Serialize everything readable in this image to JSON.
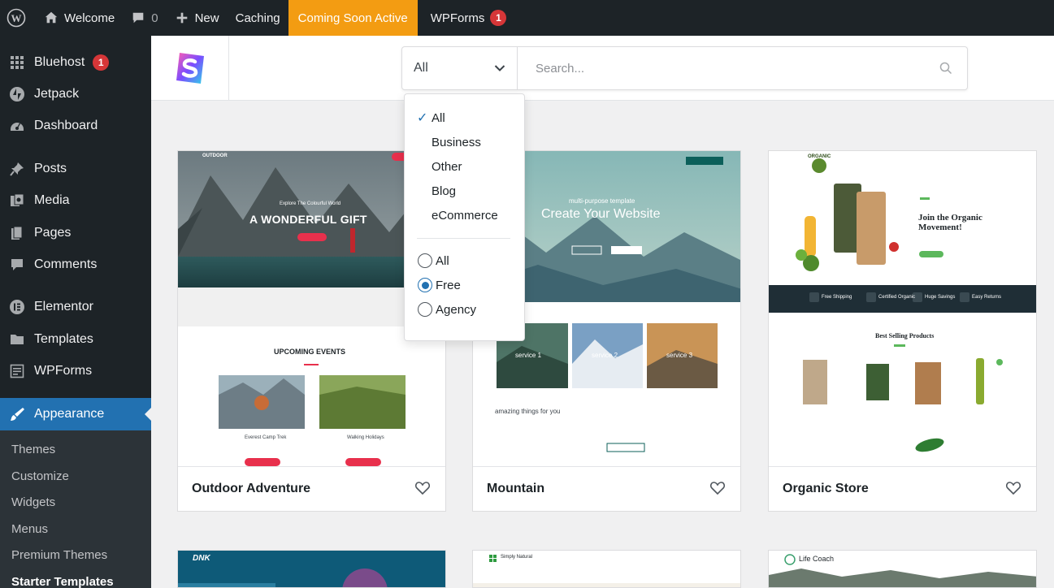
{
  "adminbar": {
    "site_name": "Welcome",
    "comments_count": "0",
    "new_label": "New",
    "caching_label": "Caching",
    "coming_soon_label": "Coming Soon Active",
    "wpforms_label": "WPForms",
    "wpforms_badge": "1",
    "highlight_color": "#f39c12"
  },
  "sidebar": {
    "items": [
      {
        "label": "Bluehost",
        "badge": "1",
        "icon": "grid-icon"
      },
      {
        "label": "Jetpack",
        "icon": "jetpack-icon"
      },
      {
        "label": "Dashboard",
        "icon": "dashboard-icon"
      },
      {
        "label": "Posts",
        "icon": "pin-icon"
      },
      {
        "label": "Media",
        "icon": "media-icon"
      },
      {
        "label": "Pages",
        "icon": "pages-icon"
      },
      {
        "label": "Comments",
        "icon": "comment-icon"
      },
      {
        "label": "Elementor",
        "icon": "elementor-icon"
      },
      {
        "label": "Templates",
        "icon": "folder-icon"
      },
      {
        "label": "WPForms",
        "icon": "form-icon"
      },
      {
        "label": "Appearance",
        "icon": "brush-icon"
      }
    ],
    "submenu": [
      "Themes",
      "Customize",
      "Widgets",
      "Menus",
      "Premium Themes",
      "Starter Templates"
    ],
    "active_color": "#2271b1"
  },
  "filter": {
    "selected_category": "All",
    "search_placeholder": "Search..."
  },
  "dropdown": {
    "categories": [
      "All",
      "Business",
      "Other",
      "Blog",
      "eCommerce"
    ],
    "types": [
      "All",
      "Free",
      "Agency"
    ],
    "selected_type": "Free"
  },
  "cards": [
    {
      "title": "Outdoor Adventure",
      "preview": {
        "brand": "OUTDOOR",
        "tagline": "Explore The Colourful World",
        "headline": "A WONDERFUL GIFT",
        "section": "UPCOMING EVENTS",
        "event1": "Everest Camp Trek",
        "event2": "Walking Holidays"
      }
    },
    {
      "title": "Mountain",
      "preview": {
        "kicker": "multi-purpose template",
        "headline": "Create Your Website",
        "services": [
          "service 1",
          "service 2",
          "service 3"
        ],
        "about": "amazing things for you"
      }
    },
    {
      "title": "Organic Store",
      "preview": {
        "brand": "ORGANIC",
        "headline": "Join the Organic Movement!",
        "features": [
          "Free Shipping",
          "Certified Organic",
          "Huge Savings",
          "Easy Returns"
        ],
        "section": "Best Selling Products"
      }
    },
    {
      "title": "",
      "preview": {
        "brand": "DNK"
      }
    },
    {
      "title": "",
      "preview": {
        "brand": "Simply Natural"
      }
    },
    {
      "title": "",
      "preview": {
        "brand": "Life Coach"
      }
    }
  ]
}
